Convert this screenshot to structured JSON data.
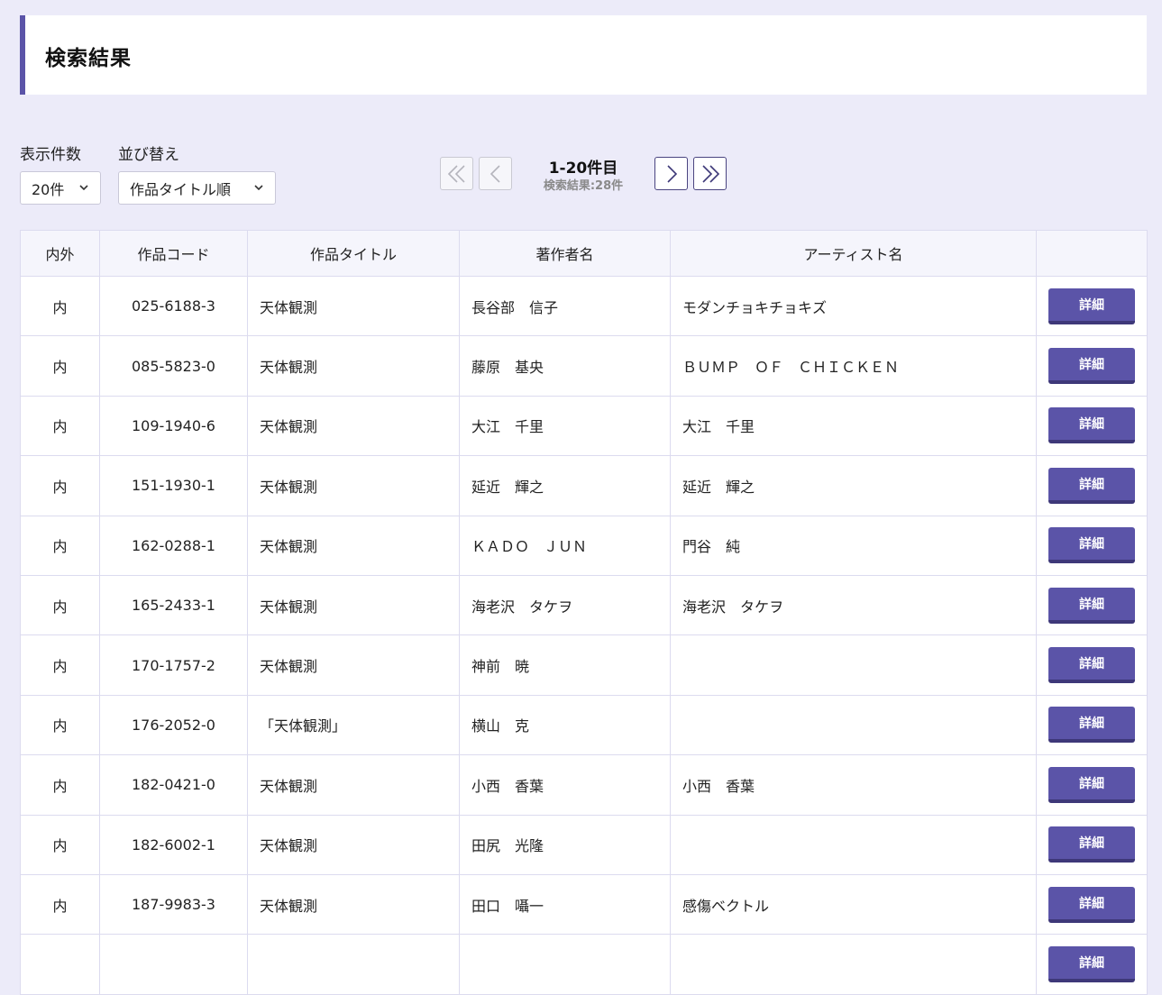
{
  "header": {
    "title": "検索結果"
  },
  "controls": {
    "count_label": "表示件数",
    "count_value": "20件",
    "sort_label": "並び替え",
    "sort_value": "作品タイトル順"
  },
  "pager": {
    "range": "1-20件目",
    "total": "検索結果:28件"
  },
  "table": {
    "headers": {
      "inout": "内外",
      "code": "作品コード",
      "title": "作品タイトル",
      "author": "著作者名",
      "artist": "アーティスト名",
      "action": ""
    },
    "detail_label": "詳細",
    "rows": [
      {
        "inout": "内",
        "code": "025-6188-3",
        "title": "天体観測",
        "author": "長谷部　信子",
        "artist": "モダンチョキチョキズ"
      },
      {
        "inout": "内",
        "code": "085-5823-0",
        "title": "天体観測",
        "author": "藤原　基央",
        "artist": "ＢＵＭＰ　ＯＦ　ＣＨＩＣＫＥＮ"
      },
      {
        "inout": "内",
        "code": "109-1940-6",
        "title": "天体観測",
        "author": "大江　千里",
        "artist": "大江　千里"
      },
      {
        "inout": "内",
        "code": "151-1930-1",
        "title": "天体観測",
        "author": "延近　輝之",
        "artist": "延近　輝之"
      },
      {
        "inout": "内",
        "code": "162-0288-1",
        "title": "天体観測",
        "author": "ＫＡＤＯ　ＪＵＮ",
        "artist": "門谷　純"
      },
      {
        "inout": "内",
        "code": "165-2433-1",
        "title": "天体観測",
        "author": "海老沢　タケヲ",
        "artist": "海老沢　タケヲ"
      },
      {
        "inout": "内",
        "code": "170-1757-2",
        "title": "天体観測",
        "author": "神前　暁",
        "artist": ""
      },
      {
        "inout": "内",
        "code": "176-2052-0",
        "title": "「天体観測」",
        "author": "横山　克",
        "artist": ""
      },
      {
        "inout": "内",
        "code": "182-0421-0",
        "title": "天体観測",
        "author": "小西　香葉",
        "artist": "小西　香葉"
      },
      {
        "inout": "内",
        "code": "182-6002-1",
        "title": "天体観測",
        "author": "田尻　光隆",
        "artist": ""
      },
      {
        "inout": "内",
        "code": "187-9983-3",
        "title": "天体観測",
        "author": "田口　囁一",
        "artist": "感傷ベクトル"
      },
      {
        "inout": "",
        "code": "",
        "title": "",
        "author": "",
        "artist": ""
      }
    ]
  }
}
